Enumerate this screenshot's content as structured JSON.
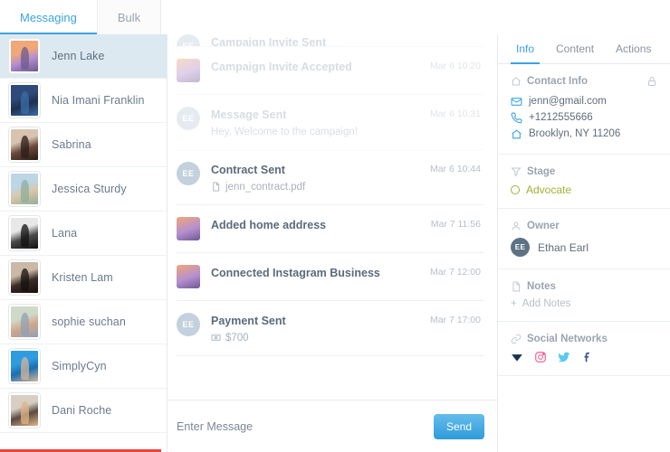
{
  "top_tabs": [
    {
      "label": "Messaging",
      "active": true
    },
    {
      "label": "Bulk",
      "active": false
    }
  ],
  "contacts": [
    {
      "name": "Jenn Lake",
      "selected": true,
      "avatar_colors": [
        "#f0a878",
        "#b48fd0",
        "#6d5a8e"
      ]
    },
    {
      "name": "Nia Imani Franklin",
      "selected": false,
      "avatar_colors": [
        "#2f4a7a",
        "#1f3050",
        "#3a6ea8"
      ]
    },
    {
      "name": "Sabrina",
      "selected": false,
      "avatar_colors": [
        "#d8c3b0",
        "#6b4a3c",
        "#2a1c18"
      ]
    },
    {
      "name": "Jessica Sturdy",
      "selected": false,
      "avatar_colors": [
        "#bcd6e6",
        "#d9c7a8",
        "#8fae9a"
      ]
    },
    {
      "name": "Lana",
      "selected": false,
      "avatar_colors": [
        "#e8e8e8",
        "#4a4a4a",
        "#111111"
      ]
    },
    {
      "name": "Kristen Lam",
      "selected": false,
      "avatar_colors": [
        "#cbb9a8",
        "#3a2c26",
        "#15100e"
      ]
    },
    {
      "name": "sophie suchan",
      "selected": false,
      "avatar_colors": [
        "#cfd9c8",
        "#d2a88a",
        "#8fa0b5"
      ]
    },
    {
      "name": "SimplyCyn",
      "selected": false,
      "avatar_colors": [
        "#2f9ce0",
        "#1a6fb0",
        "#d8b49a"
      ]
    },
    {
      "name": "Dani Roche",
      "selected": false,
      "avatar_colors": [
        "#d8cfc4",
        "#5a4a40",
        "#e0b488"
      ]
    }
  ],
  "timeline": [
    {
      "title": "Campaign Invite Sent",
      "time": "",
      "sub": "",
      "sub_icon": "",
      "icon_type": "ee",
      "icon_text": "EE",
      "faded": true,
      "clipped": true
    },
    {
      "title": "Campaign Invite Accepted",
      "time": "Mar 6 10:20",
      "sub": "",
      "sub_icon": "",
      "icon_type": "photo",
      "icon_text": "",
      "faded": true,
      "clipped": false
    },
    {
      "title": "Message Sent",
      "time": "Mar 6 10:31",
      "sub": "Hey, Welcome to the campaign!",
      "sub_icon": "",
      "icon_type": "ee",
      "icon_text": "EE",
      "faded": true,
      "clipped": false
    },
    {
      "title": "Contract Sent",
      "time": "Mar 6 10:44",
      "sub": "jenn_contract.pdf",
      "sub_icon": "file-icon",
      "icon_type": "ee",
      "icon_text": "EE",
      "faded": false,
      "clipped": false
    },
    {
      "title": "Added home address",
      "time": "Mar 7 11:56",
      "sub": "",
      "sub_icon": "",
      "icon_type": "photo",
      "icon_text": "",
      "faded": false,
      "clipped": false
    },
    {
      "title": "Connected Instagram Business",
      "time": "Mar 7 12:00",
      "sub": "",
      "sub_icon": "",
      "icon_type": "photo",
      "icon_text": "",
      "faded": false,
      "clipped": false
    },
    {
      "title": "Payment Sent",
      "time": "Mar 7 17:00",
      "sub": "$700",
      "sub_icon": "money-icon",
      "icon_type": "ee",
      "icon_text": "EE",
      "faded": false,
      "clipped": false
    }
  ],
  "composer": {
    "placeholder": "Enter Message",
    "value": "",
    "send_label": "Send"
  },
  "info_tabs": [
    {
      "label": "Info",
      "active": true
    },
    {
      "label": "Content",
      "active": false
    },
    {
      "label": "Actions",
      "active": false
    }
  ],
  "contact_info": {
    "heading": "Contact Info",
    "email": "jenn@gmail.com",
    "phone": "+1212555666",
    "address": "Brooklyn, NY 11206"
  },
  "stage": {
    "heading": "Stage",
    "value": "Advocate",
    "color": "#a2b133"
  },
  "owner": {
    "heading": "Owner",
    "name": "Ethan Earl",
    "initials": "EE"
  },
  "notes": {
    "heading": "Notes",
    "add_label": "Add Notes"
  },
  "social": {
    "heading": "Social Networks",
    "networks": [
      {
        "name": "bloglovin-icon",
        "color": "#17334d"
      },
      {
        "name": "instagram-icon",
        "color": "#f06292"
      },
      {
        "name": "twitter-icon",
        "color": "#5bc8f5"
      },
      {
        "name": "facebook-icon",
        "color": "#3b5998"
      }
    ]
  },
  "accent": "#3aa3e3"
}
